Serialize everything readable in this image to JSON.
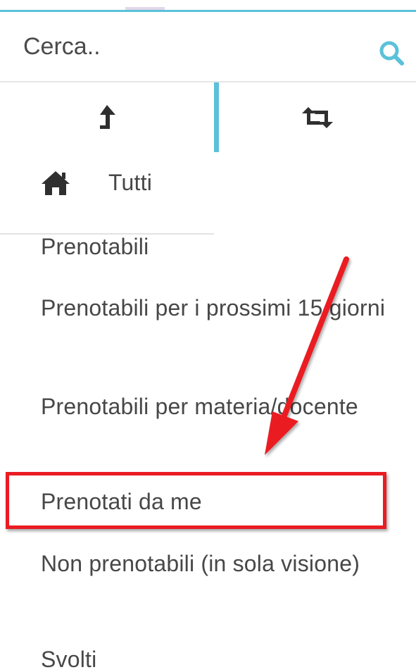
{
  "colors": {
    "accent": "#5bc1da",
    "text": "#474747",
    "annotation": "#ea1c23"
  },
  "search": {
    "placeholder": "Cerca..",
    "icon": "search-icon"
  },
  "tabs": [
    {
      "icon": "upload-arrow-icon"
    },
    {
      "icon": "retweet-icon"
    }
  ],
  "menu": {
    "items": [
      {
        "label": "Tutti",
        "icon": "home-icon"
      },
      {
        "label": "Prenotabili"
      },
      {
        "label": "Prenotabili per i prossimi 15 giorni"
      },
      {
        "label": "Prenotabili per materia/docente"
      },
      {
        "label": "Prenotati da me",
        "highlighted": true
      },
      {
        "label": "Non prenotabili (in sola visione)"
      },
      {
        "label": "Svolti"
      }
    ]
  }
}
